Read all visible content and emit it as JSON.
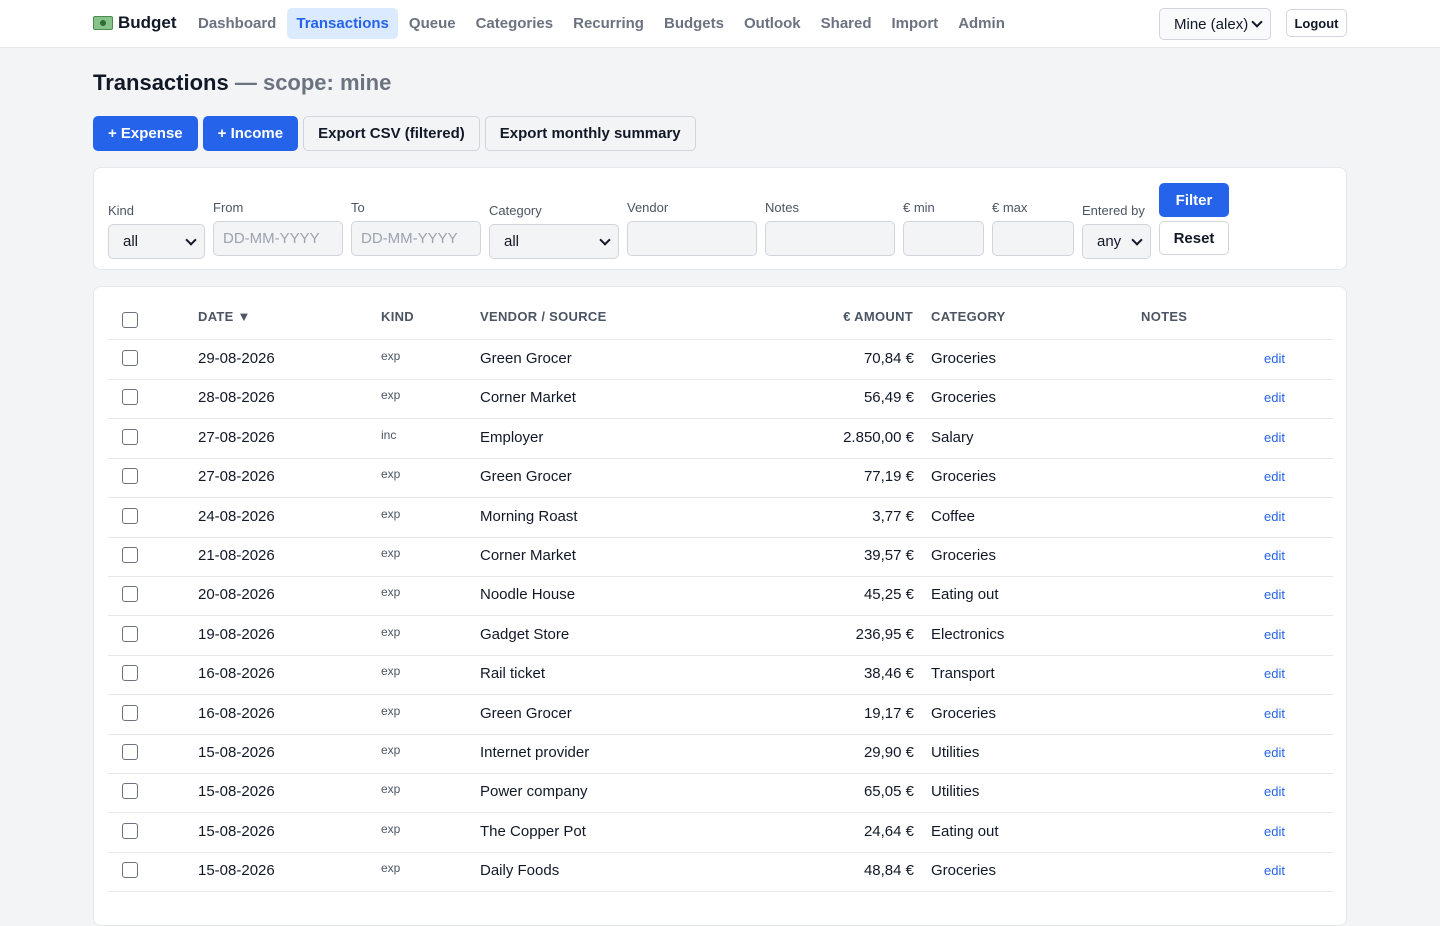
{
  "app": {
    "brand": "Budget",
    "nav": [
      {
        "label": "Dashboard",
        "active": false
      },
      {
        "label": "Transactions",
        "active": true
      },
      {
        "label": "Queue",
        "active": false
      },
      {
        "label": "Categories",
        "active": false
      },
      {
        "label": "Recurring",
        "active": false
      },
      {
        "label": "Budgets",
        "active": false
      },
      {
        "label": "Outlook",
        "active": false
      },
      {
        "label": "Shared",
        "active": false
      },
      {
        "label": "Import",
        "active": false
      },
      {
        "label": "Admin",
        "active": false
      }
    ],
    "scope_select": "Mine (alex)",
    "logout_label": "Logout"
  },
  "page": {
    "title": "Transactions",
    "scope_label": "— scope: mine"
  },
  "actions": {
    "add_expense": "+ Expense",
    "add_income": "+ Income",
    "export_csv": "Export CSV (filtered)",
    "export_summary": "Export monthly summary"
  },
  "filters": {
    "kind": {
      "label": "Kind",
      "value": "all"
    },
    "from": {
      "label": "From",
      "placeholder": "DD-MM-YYYY"
    },
    "to": {
      "label": "To",
      "placeholder": "DD-MM-YYYY"
    },
    "category": {
      "label": "Category",
      "value": "all"
    },
    "vendor": {
      "label": "Vendor",
      "value": ""
    },
    "notes": {
      "label": "Notes",
      "value": ""
    },
    "min": {
      "label": "€ min",
      "value": ""
    },
    "max": {
      "label": "€ max",
      "value": ""
    },
    "entered_by": {
      "label": "Entered by",
      "value": "any"
    },
    "filter_button": "Filter",
    "reset_button": "Reset"
  },
  "table": {
    "columns": {
      "date": "DATE ▼",
      "kind": "KIND",
      "vendor": "VENDOR / SOURCE",
      "amount": "€ AMOUNT",
      "category": "CATEGORY",
      "notes": "NOTES"
    },
    "edit_label": "edit",
    "rows": [
      {
        "date": "29-08-2026",
        "kind": "exp",
        "vendor": "Green Grocer",
        "amount": "70,84 €",
        "category": "Groceries",
        "notes": ""
      },
      {
        "date": "28-08-2026",
        "kind": "exp",
        "vendor": "Corner Market",
        "amount": "56,49 €",
        "category": "Groceries",
        "notes": ""
      },
      {
        "date": "27-08-2026",
        "kind": "inc",
        "vendor": "Employer",
        "amount": "2.850,00 €",
        "category": "Salary",
        "notes": ""
      },
      {
        "date": "27-08-2026",
        "kind": "exp",
        "vendor": "Green Grocer",
        "amount": "77,19 €",
        "category": "Groceries",
        "notes": ""
      },
      {
        "date": "24-08-2026",
        "kind": "exp",
        "vendor": "Morning Roast",
        "amount": "3,77 €",
        "category": "Coffee",
        "notes": ""
      },
      {
        "date": "21-08-2026",
        "kind": "exp",
        "vendor": "Corner Market",
        "amount": "39,57 €",
        "category": "Groceries",
        "notes": ""
      },
      {
        "date": "20-08-2026",
        "kind": "exp",
        "vendor": "Noodle House",
        "amount": "45,25 €",
        "category": "Eating out",
        "notes": ""
      },
      {
        "date": "19-08-2026",
        "kind": "exp",
        "vendor": "Gadget Store",
        "amount": "236,95 €",
        "category": "Electronics",
        "notes": ""
      },
      {
        "date": "16-08-2026",
        "kind": "exp",
        "vendor": "Rail ticket",
        "amount": "38,46 €",
        "category": "Transport",
        "notes": ""
      },
      {
        "date": "16-08-2026",
        "kind": "exp",
        "vendor": "Green Grocer",
        "amount": "19,17 €",
        "category": "Groceries",
        "notes": ""
      },
      {
        "date": "15-08-2026",
        "kind": "exp",
        "vendor": "Internet provider",
        "amount": "29,90 €",
        "category": "Utilities",
        "notes": ""
      },
      {
        "date": "15-08-2026",
        "kind": "exp",
        "vendor": "Power company",
        "amount": "65,05 €",
        "category": "Utilities",
        "notes": ""
      },
      {
        "date": "15-08-2026",
        "kind": "exp",
        "vendor": "The Copper Pot",
        "amount": "24,64 €",
        "category": "Eating out",
        "notes": ""
      },
      {
        "date": "15-08-2026",
        "kind": "exp",
        "vendor": "Daily Foods",
        "amount": "48,84 €",
        "category": "Groceries",
        "notes": ""
      }
    ]
  }
}
